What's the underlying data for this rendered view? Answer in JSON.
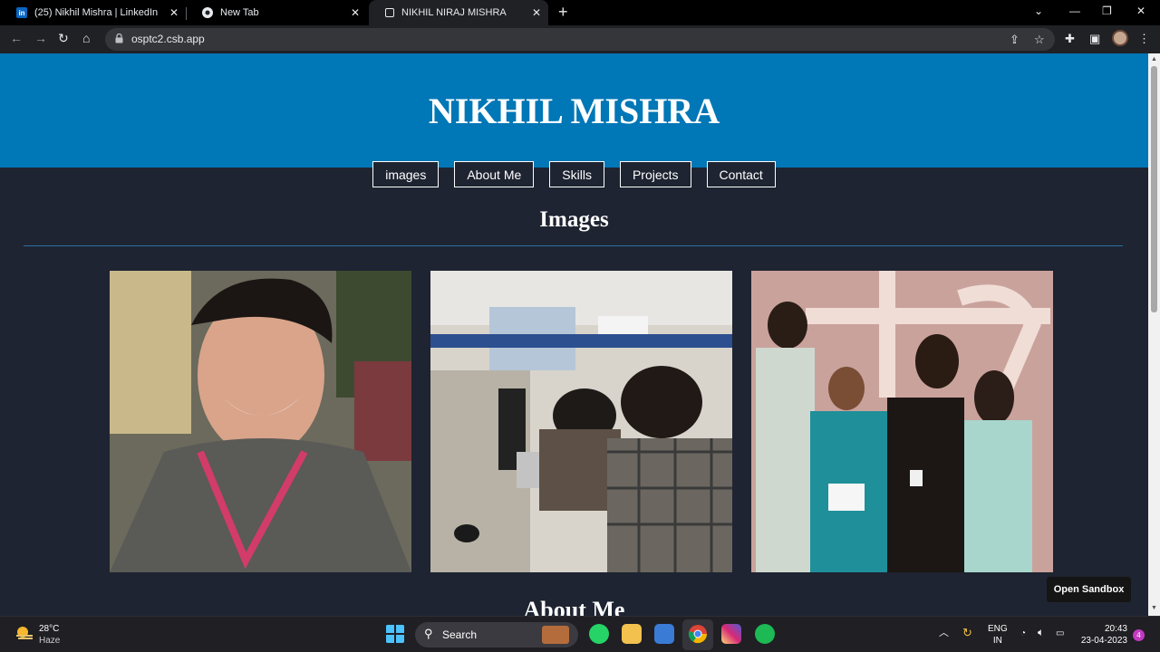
{
  "browser": {
    "tabs": [
      {
        "title": "(25) Nikhil Mishra | LinkedIn",
        "favicon": "linkedin-icon"
      },
      {
        "title": "New Tab",
        "favicon": "chrome-icon"
      },
      {
        "title": "NIKHIL NIRAJ MISHRA",
        "favicon": "codesandbox-icon"
      }
    ],
    "active_tab": 2,
    "url": "osptc2.csb.app"
  },
  "page": {
    "site_title": "NIKHIL MISHRA",
    "nav": [
      "images",
      "About Me",
      "Skills",
      "Projects",
      "Contact"
    ],
    "images_heading": "Images",
    "about_heading": "About Me",
    "photos": [
      {
        "description_icon": "portrait-photo"
      },
      {
        "description_icon": "computer-lab-photo"
      },
      {
        "description_icon": "award-ceremony-photo"
      }
    ],
    "open_sandbox": "Open Sandbox",
    "colors": {
      "header": "#0077b6",
      "background": "#1e2431"
    }
  },
  "taskbar": {
    "weather_temp": "28°C",
    "weather_desc": "Haze",
    "search_label": "Search",
    "language_top": "ENG",
    "language_bottom": "IN",
    "time": "20:43",
    "date": "23-04-2023",
    "notification_count": "4"
  }
}
